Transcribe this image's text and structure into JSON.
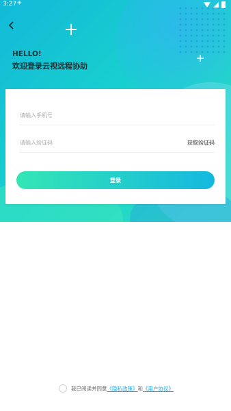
{
  "status_bar": {
    "time": "3:27",
    "sun_icon": "☀"
  },
  "colors": {
    "gradient_start": "#34e6b6",
    "gradient_end": "#14b8df",
    "link": "#1aa9e6"
  },
  "header": {
    "hello": "HELLO!",
    "welcome": "欢迎登录云视远程协助"
  },
  "form": {
    "phone_placeholder": "请输入手机号",
    "code_placeholder": "请输入验证码",
    "get_code_label": "获取验证码",
    "login_label": "登录"
  },
  "agreement": {
    "prefix": "我已阅读并同意",
    "privacy_policy": "《隐私政策》",
    "and": "和",
    "user_agreement": "《用户协议》"
  }
}
